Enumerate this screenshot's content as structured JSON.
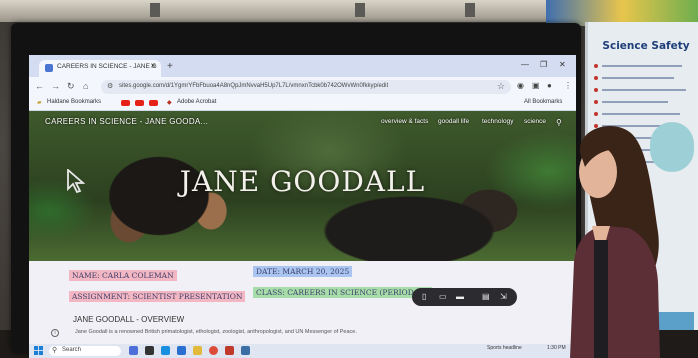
{
  "browser": {
    "tab_title": "CAREERS IN SCIENCE - JANE G",
    "url": "sites.google.com/d/1YgmrYFbFbuoa4A8nQpJmNvvaH5Up7L7L/vmnxnTcbk0b742OWvWn0fkkyp/edit",
    "bookmarks": [
      "Haldane Bookmarks",
      "Adobe Acrobat",
      "All Bookmarks"
    ]
  },
  "site": {
    "title": "CAREERS IN SCIENCE - JANE GOODA...",
    "nav": [
      "overview & facts",
      "goodall life",
      "technology",
      "science"
    ],
    "hero_heading": "JANE GOODALL"
  },
  "fields": {
    "name": "NAME: CARLA COLEMAN",
    "date": "DATE: MARCH 20, 2025",
    "assignment": "ASSIGNMENT: SCIENTIST PRESENTATION",
    "class": "CLASS: CAREERS IN SCIENCE (PERIOD 9B)"
  },
  "overview": {
    "heading": "JANE GOODALL - OVERVIEW",
    "bullet": "Jane Goodall is a renowned British primatologist, ethologist, zoologist, anthropologist, and UN Messenger of Peace."
  },
  "taskbar": {
    "search_label": "Search",
    "tray_status": "Sports headline",
    "tray_time": "1:30 PM"
  },
  "poster": {
    "title": "Science Safety"
  },
  "colors": {
    "name_highlight": "#f2b7c2",
    "date_highlight": "#a9c5f0",
    "class_highlight": "#a6dda8"
  }
}
